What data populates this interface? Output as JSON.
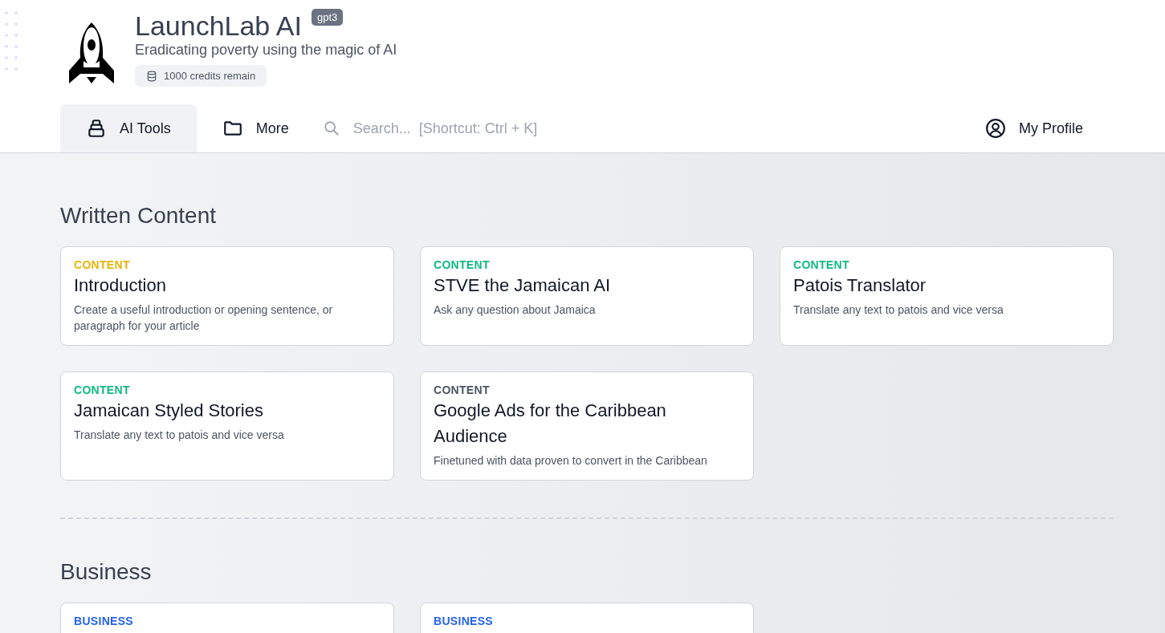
{
  "brand": {
    "title": "LaunchLab AI",
    "badge": "gpt3",
    "tagline": "Eradicating poverty using the magic of AI",
    "credits": "1000 credits remain"
  },
  "nav": {
    "tabs": [
      {
        "label": "AI Tools",
        "kind": "tools",
        "selected": true
      },
      {
        "label": "More",
        "kind": "folder",
        "selected": false
      }
    ],
    "search": {
      "placeholder": "Search...  [Shortcut: Ctrl + K]"
    },
    "profile": "My Profile"
  },
  "sections": [
    {
      "title": "Written Content",
      "cards": [
        {
          "category": "CONTENT",
          "color": "#eab308",
          "title": "Introduction",
          "description": "Create a useful introduction or opening sentence, or paragraph for your article"
        },
        {
          "category": "CONTENT",
          "color": "#10b981",
          "title": "STVE the Jamaican AI",
          "description": "Ask any question about Jamaica"
        },
        {
          "category": "CONTENT",
          "color": "#10b981",
          "title": "Patois Translator",
          "description": "Translate any text to patois and vice versa"
        },
        {
          "category": "CONTENT",
          "color": "#10b981",
          "title": "Jamaican Styled Stories",
          "description": "Translate any text to patois and vice versa"
        },
        {
          "category": "CONTENT",
          "color": "#4b5563",
          "title": "Google Ads for the Caribbean Audience",
          "description": "Finetuned with data proven to convert in the Caribbean"
        }
      ]
    },
    {
      "title": "Business",
      "cards": [
        {
          "category": "BUSINESS",
          "color": "#2563eb"
        },
        {
          "category": "BUSINESS",
          "color": "#2563eb"
        }
      ]
    }
  ]
}
